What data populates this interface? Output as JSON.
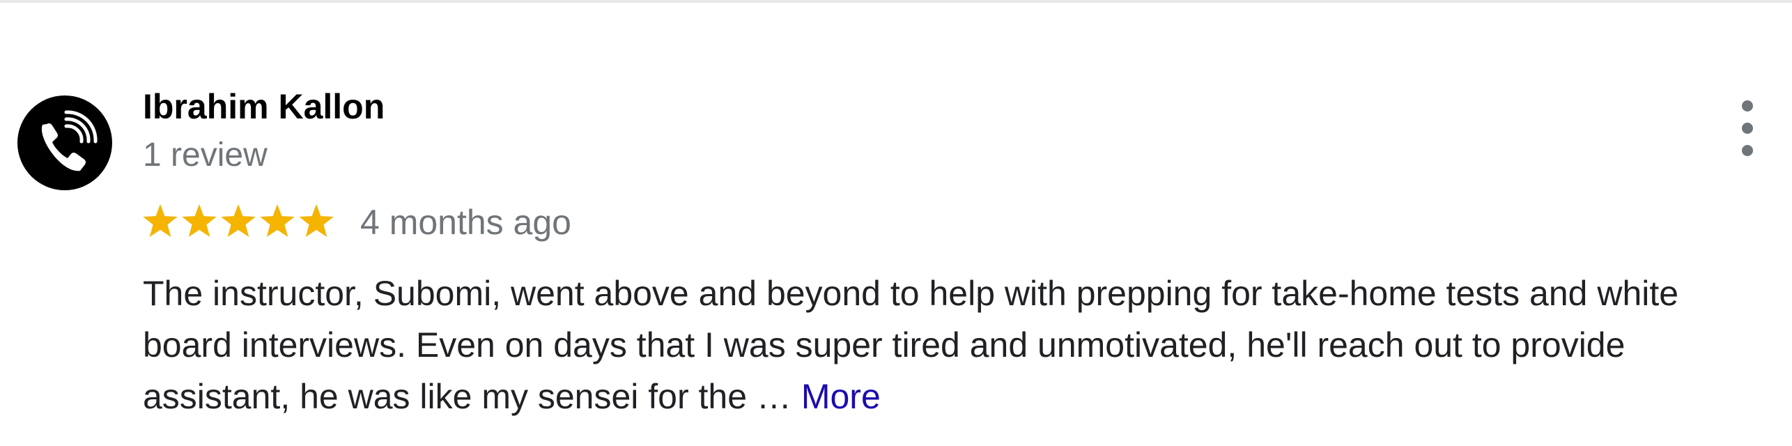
{
  "review": {
    "author_name": "Ibrahim Kallon",
    "review_count": "1 review",
    "rating": 5,
    "rating_max": 5,
    "time_ago": "4 months ago",
    "text": "The instructor, Subomi, went above and beyond to help with prepping for take-home tests and white board interviews. Even on days that I was super tired and unmotivated, he'll reach out to provide assistant, he was like my sensei for the …",
    "more_label": "More"
  },
  "icons": {
    "avatar": "phone-handset-icon",
    "star": "star-icon",
    "menu": "more-vertical-icon"
  },
  "colors": {
    "star_filled": "#f4b400",
    "link": "#1a0dab",
    "secondary_text": "#70757a",
    "avatar_bg": "#000000"
  }
}
